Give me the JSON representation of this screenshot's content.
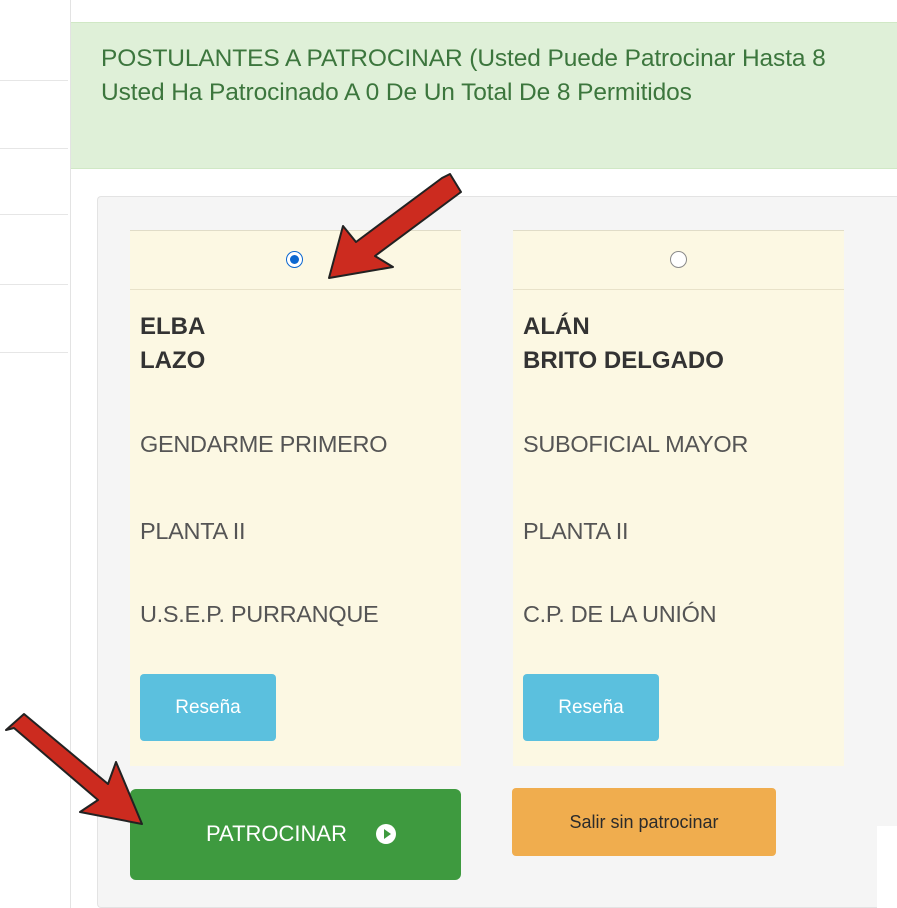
{
  "alert": {
    "line1": "POSTULANTES A PATROCINAR (Usted Puede Patrocinar Hasta 8",
    "line2": "Usted Ha Patrocinado A 0 De Un Total De 8 Permitidos"
  },
  "candidates": [
    {
      "selected": true,
      "first_name": "ELBA",
      "last_name": "LAZO",
      "rank": "GENDARME PRIMERO",
      "plant": "PLANTA II",
      "unit": "U.S.E.P. PURRANQUE",
      "button_label": "Reseña"
    },
    {
      "selected": false,
      "first_name": "ALÁN",
      "last_name": "BRITO DELGADO",
      "rank": "SUBOFICIAL MAYOR",
      "plant": "PLANTA II",
      "unit": "C.P. DE LA UNIÓN",
      "button_label": "Reseña"
    }
  ],
  "actions": {
    "sponsor_label": "PATROCINAR",
    "exit_label": "Salir sin patrocinar"
  },
  "colors": {
    "alert_bg": "#dff0d8",
    "alert_text": "#3c763d",
    "card_bg": "#fcf8e3",
    "info_button": "#5bc0de",
    "success_button": "#3e9a3f",
    "warning_button": "#f0ad4e",
    "annotation_arrow": "#cc2b1f"
  }
}
